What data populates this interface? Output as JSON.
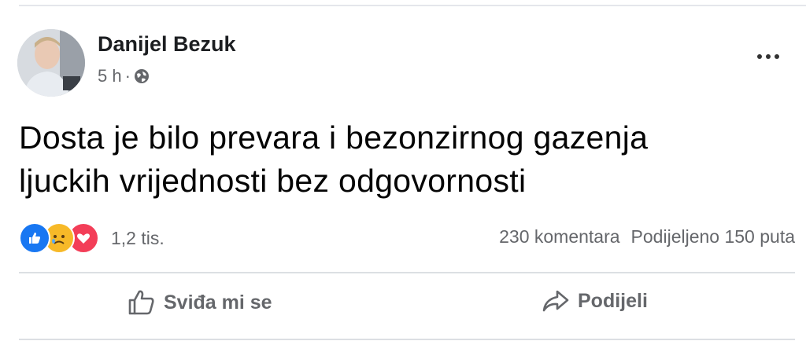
{
  "post": {
    "author": "Danijel Bezuk",
    "time": "5 h",
    "separator": "·",
    "privacy_icon": "globe-icon",
    "text_line1": "Dosta je bilo prevara i bezonzirnog gazenja",
    "text_line2": "ljuckih vrijednosti bez odgovornosti"
  },
  "reactions": {
    "icons": [
      "like-reaction-icon",
      "sad-reaction-icon",
      "love-reaction-icon"
    ],
    "count": "1,2 tis."
  },
  "stats": {
    "comments": "230 komentara",
    "shares": "Podijeljeno 150 puta"
  },
  "actions": {
    "like_label": "Sviđa mi se",
    "share_label": "Podijeli"
  },
  "colors": {
    "like_blue": "#1877f2",
    "sad_yellow": "#f7b928",
    "love_red": "#f33e58",
    "secondary_text": "#65676b"
  }
}
